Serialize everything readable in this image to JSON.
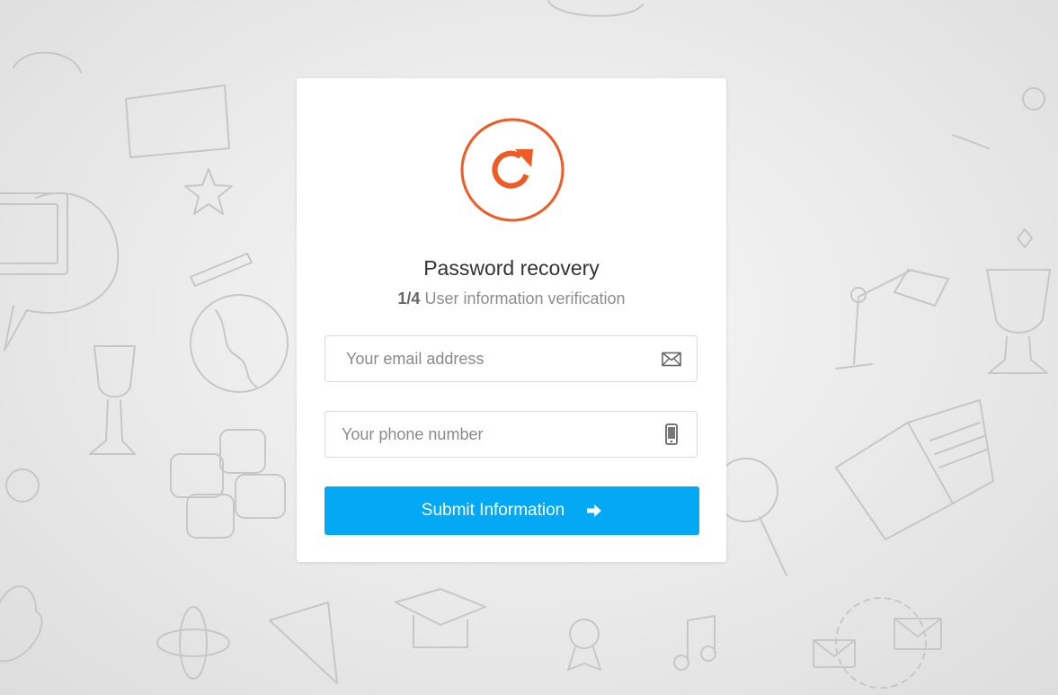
{
  "recovery": {
    "title": "Password recovery",
    "step": "1/4",
    "step_description": "User information verification",
    "email_placeholder": "Your email address",
    "phone_placeholder": "Your phone number",
    "submit_label": "Submit Information"
  },
  "icons": {
    "logo": "refresh-icon",
    "email": "envelope-icon",
    "phone": "mobile-phone-icon",
    "submit": "arrow-right-icon"
  },
  "colors": {
    "accent": "#f05a24",
    "button": "#03a9f4",
    "background": "#e6e6e6"
  }
}
